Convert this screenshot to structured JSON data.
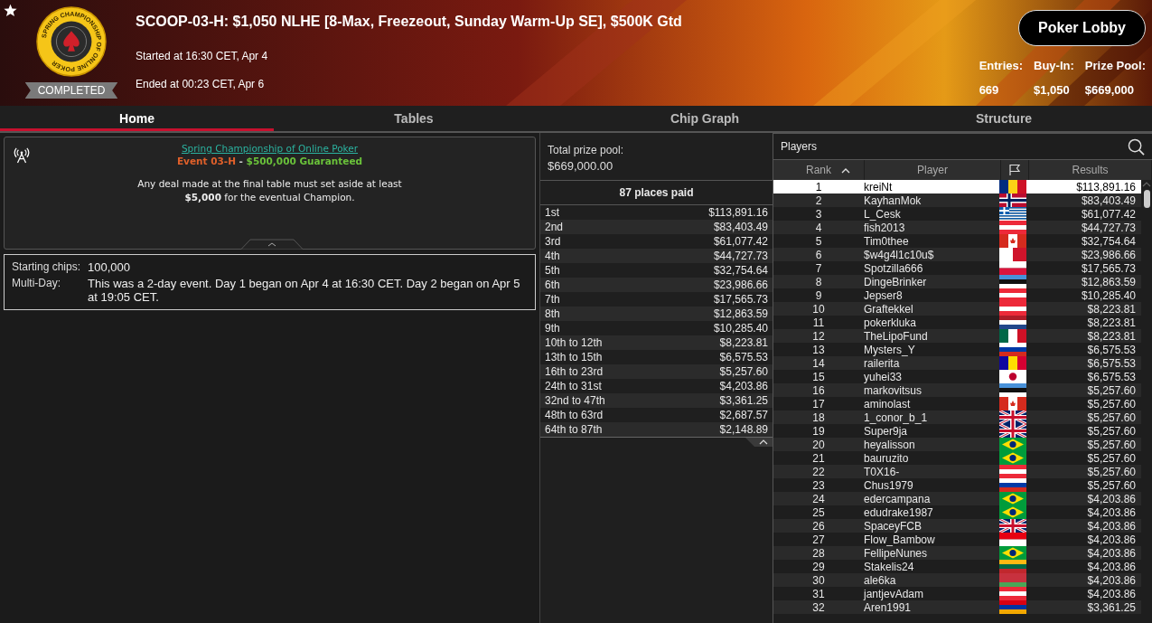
{
  "header": {
    "starred": true,
    "logo_text": "SPRING CHAMPIONSHIP OF ONLINE POKER",
    "status": "COMPLETED",
    "title": "SCOOP-03-H: $1,050 NLHE [8-Max, Freezeout, Sunday Warm-Up SE], $500K Gtd",
    "started": "Started at 16:30 CET, Apr 4",
    "ended": "Ended at 00:23 CET, Apr 6",
    "lobby_button": "Poker Lobby",
    "stats": [
      {
        "label": "Entries:",
        "value": "669"
      },
      {
        "label": "Buy-In:",
        "value": "$1,050"
      },
      {
        "label": "Prize Pool:",
        "value": "$669,000"
      }
    ]
  },
  "tabs": [
    {
      "label": "Home",
      "selected": true
    },
    {
      "label": "Tables",
      "selected": false
    },
    {
      "label": "Chip Graph",
      "selected": false
    },
    {
      "label": "Structure",
      "selected": false
    }
  ],
  "notice": {
    "link": "Spring Championship of Online Poker",
    "event": "Event 03-H",
    "separator": " - ",
    "guarantee": "$500,000 Guaranteed",
    "message": "Any deal made at the final table must set aside at least **$5,000** for the eventual Champion."
  },
  "details": [
    {
      "label": "Starting chips:",
      "value": "100,000"
    },
    {
      "label": "Multi-Day:",
      "value": "This was a 2-day event. Day 1 began on Apr 4 at 16:30 CET. Day 2 began on Apr 5 at 19:05 CET."
    }
  ],
  "prize_pool": {
    "label": "Total prize pool:",
    "value": "$669,000.00",
    "places_paid": "87 places paid",
    "payouts": [
      [
        "1st",
        "$113,891.16"
      ],
      [
        "2nd",
        "$83,403.49"
      ],
      [
        "3rd",
        "$61,077.42"
      ],
      [
        "4th",
        "$44,727.73"
      ],
      [
        "5th",
        "$32,754.64"
      ],
      [
        "6th",
        "$23,986.66"
      ],
      [
        "7th",
        "$17,565.73"
      ],
      [
        "8th",
        "$12,863.59"
      ],
      [
        "9th",
        "$10,285.40"
      ],
      [
        "10th to 12th",
        "$8,223.81"
      ],
      [
        "13th to 15th",
        "$6,575.53"
      ],
      [
        "16th to 23rd",
        "$5,257.60"
      ],
      [
        "24th to 31st",
        "$4,203.86"
      ],
      [
        "32nd to 47th",
        "$3,361.25"
      ],
      [
        "48th to 63rd",
        "$2,687.57"
      ],
      [
        "64th to 87th",
        "$2,148.89"
      ]
    ]
  },
  "players": {
    "title": "Players",
    "columns": [
      "Rank",
      "Player",
      "Results"
    ],
    "rows": [
      {
        "rank": "1",
        "name": "kreiNt",
        "kind": "ro",
        "result": "$113,891.16",
        "selected": true
      },
      {
        "rank": "2",
        "name": "KayhanMok",
        "kind": "no",
        "result": "$83,403.49",
        "selected": false
      },
      {
        "rank": "3",
        "name": "L_Cesk",
        "kind": "gr",
        "result": "$61,077.42",
        "selected": false
      },
      {
        "rank": "4",
        "name": "fish2013",
        "kind": "at",
        "result": "$44,727.73",
        "selected": false
      },
      {
        "rank": "5",
        "name": "Tim0thee",
        "kind": "ca",
        "result": "$32,754.64",
        "selected": false
      },
      {
        "rank": "6",
        "name": "$w4g4l1c10u$",
        "kind": "mt",
        "result": "$23,986.66",
        "selected": false
      },
      {
        "rank": "7",
        "name": "Spotzilla666",
        "kind": "pl",
        "result": "$17,565.73",
        "selected": false
      },
      {
        "rank": "8",
        "name": "DingeBrinker",
        "kind": "ee",
        "result": "$12,863.59",
        "selected": false
      },
      {
        "rank": "9",
        "name": "Jepser8",
        "kind": "at",
        "result": "$10,285.40",
        "selected": false
      },
      {
        "rank": "10",
        "name": "Graftekkel",
        "kind": "at",
        "result": "$8,223.81",
        "selected": false
      },
      {
        "rank": "11",
        "name": "pokerkluka",
        "kind": "nl",
        "result": "$8,223.81",
        "selected": false
      },
      {
        "rank": "12",
        "name": "TheLipoFund",
        "kind": "mx",
        "result": "$8,223.81",
        "selected": false
      },
      {
        "rank": "13",
        "name": "Mysters_Y",
        "kind": "ru",
        "result": "$6,575.53",
        "selected": false
      },
      {
        "rank": "14",
        "name": "railerita",
        "kind": "ad",
        "result": "$6,575.53",
        "selected": false
      },
      {
        "rank": "15",
        "name": "yuhei33",
        "kind": "jp",
        "result": "$6,575.53",
        "selected": false
      },
      {
        "rank": "16",
        "name": "markovitsus",
        "kind": "ee",
        "result": "$5,257.60",
        "selected": false
      },
      {
        "rank": "17",
        "name": "aminolast",
        "kind": "ca",
        "result": "$5,257.60",
        "selected": false
      },
      {
        "rank": "18",
        "name": "1_conor_b_1",
        "kind": "gb",
        "result": "$5,257.60",
        "selected": false
      },
      {
        "rank": "19",
        "name": "Super9ja",
        "kind": "gb",
        "result": "$5,257.60",
        "selected": false
      },
      {
        "rank": "20",
        "name": "heyalisson",
        "kind": "br",
        "result": "$5,257.60",
        "selected": false
      },
      {
        "rank": "21",
        "name": "bauruzito",
        "kind": "br",
        "result": "$5,257.60",
        "selected": false
      },
      {
        "rank": "22",
        "name": "T0X16-",
        "kind": "at",
        "result": "$5,257.60",
        "selected": false
      },
      {
        "rank": "23",
        "name": "Chus1979",
        "kind": "ru",
        "result": "$5,257.60",
        "selected": false
      },
      {
        "rank": "24",
        "name": "edercampana",
        "kind": "br",
        "result": "$4,203.86",
        "selected": false
      },
      {
        "rank": "25",
        "name": "edudrake1987",
        "kind": "br",
        "result": "$4,203.86",
        "selected": false
      },
      {
        "rank": "26",
        "name": "SpaceyFCB",
        "kind": "gb",
        "result": "$4,203.86",
        "selected": false
      },
      {
        "rank": "27",
        "name": "Flow_Bambow",
        "kind": "id",
        "result": "$4,203.86",
        "selected": false
      },
      {
        "rank": "28",
        "name": "FellipeNunes",
        "kind": "br",
        "result": "$4,203.86",
        "selected": false
      },
      {
        "rank": "29",
        "name": "Stakelis24",
        "kind": "lt",
        "result": "$4,203.86",
        "selected": false
      },
      {
        "rank": "30",
        "name": "ale6ka",
        "kind": "by",
        "result": "$4,203.86",
        "selected": false
      },
      {
        "rank": "31",
        "name": "jantjevAdam",
        "kind": "at",
        "result": "$4,203.86",
        "selected": false
      },
      {
        "rank": "32",
        "name": "Aren1991",
        "kind": "am",
        "result": "$3,361.25",
        "selected": false
      }
    ]
  }
}
